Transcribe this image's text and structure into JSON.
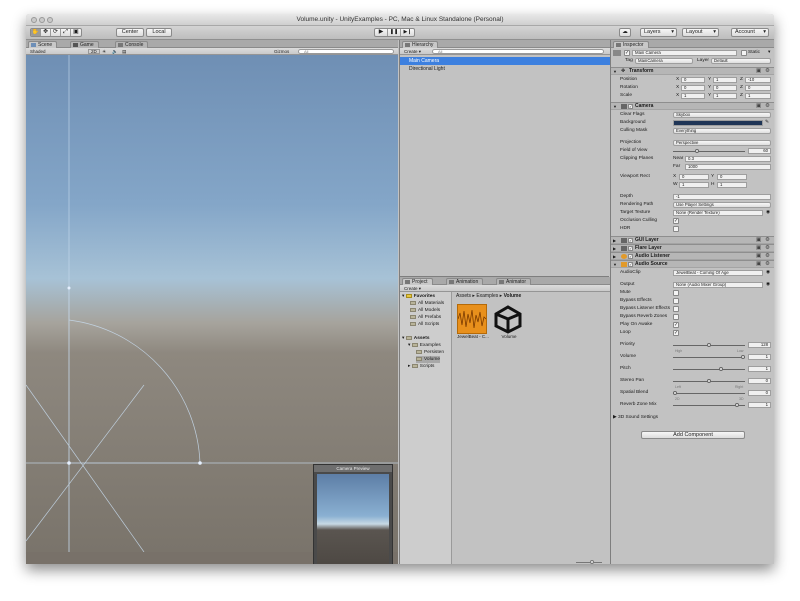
{
  "title": "Volume.unity - UnityExamples - PC, Mac & Linux Standalone (Personal)",
  "toolbar": {
    "tools": [
      "hand-icon",
      "move-icon",
      "rotate-icon",
      "scale-icon",
      "rect-icon"
    ],
    "pivot": "Center",
    "space": "Local",
    "play": "▶",
    "pause": "❚❚",
    "step": "▶❙",
    "cloud": "☁",
    "layers": "Layers",
    "layout": "Layout",
    "account": "Account"
  },
  "scene": {
    "tabs": [
      "Scene",
      "Game",
      "Console"
    ],
    "shading": "Shaded",
    "mode_2d": "2D",
    "gizmos": "Gizmos",
    "search_placeholder": "All",
    "preview_title": "Camera Preview"
  },
  "hierarchy": {
    "tab": "Hierarchy",
    "create": "Create",
    "search_placeholder": "All",
    "items": [
      "Main Camera",
      "Directional Light"
    ]
  },
  "project": {
    "tabs": [
      "Project",
      "Animation",
      "Animator"
    ],
    "create": "Create",
    "favorites_label": "Favorites",
    "favorites": [
      "All Materials",
      "All Models",
      "All Prefabs",
      "All Scripts"
    ],
    "assets_label": "Assets",
    "examples_label": "Examples",
    "example_children": [
      "Persisten",
      "Volume"
    ],
    "scripts_label": "Scripts",
    "breadcrumb": [
      "Assets",
      "Examples",
      "Volume"
    ],
    "asset_items": [
      "JewelBeat - C...",
      "Volume"
    ]
  },
  "inspector": {
    "tab": "Inspector",
    "object_name": "Main Camera",
    "static_label": "Static",
    "tag_label": "Tag",
    "tag": "MainCamera",
    "layer_label": "Layer",
    "layer": "Default",
    "transform": {
      "header": "Transform",
      "rows": [
        {
          "label": "Position",
          "x": "0",
          "y": "1",
          "z": "-10"
        },
        {
          "label": "Rotation",
          "x": "0",
          "y": "0",
          "z": "0"
        },
        {
          "label": "Scale",
          "x": "1",
          "y": "1",
          "z": "1"
        }
      ]
    },
    "camera": {
      "header": "Camera",
      "clear_flags_label": "Clear Flags",
      "clear_flags": "Skybox",
      "background_label": "Background",
      "background_color": "#1f3556",
      "culling_mask_label": "Culling Mask",
      "culling_mask": "Everything",
      "projection_label": "Projection",
      "projection": "Perspective",
      "fov_label": "Field of View",
      "fov": "60",
      "fov_fraction": 0.33,
      "clipping_label": "Clipping Planes",
      "near_label": "Near",
      "near": "0.3",
      "far_label": "Far",
      "far": "1000",
      "viewport_label": "Viewport Rect",
      "vr_x": "0",
      "vr_y": "0",
      "vr_w": "1",
      "vr_h": "1",
      "depth_label": "Depth",
      "depth": "-1",
      "rendering_path_label": "Rendering Path",
      "rendering_path": "Use Player Settings",
      "target_texture_label": "Target Texture",
      "target_texture": "None (Render Texture)",
      "occlusion_label": "Occlusion Culling",
      "hdr_label": "HDR"
    },
    "gui_layer": "GUI Layer",
    "flare_layer": "Flare Layer",
    "audio_listener": "Audio Listener",
    "audio_source": {
      "header": "Audio Source",
      "clip_label": "AudioClip",
      "clip": "JewelBeat - Coming Of Age",
      "output_label": "Output",
      "output": "None (Audio Mixer Group)",
      "mute_label": "Mute",
      "bypass_effects_label": "Bypass Effects",
      "bypass_listener_label": "Bypass Listener Effects",
      "bypass_reverb_label": "Bypass Reverb Zones",
      "play_on_awake_label": "Play On Awake",
      "loop_label": "Loop",
      "priority_label": "Priority",
      "priority": "128",
      "priority_fraction": 0.5,
      "high": "High",
      "low": "Low",
      "volume_label": "Volume",
      "volume": "1",
      "volume_fraction": 1.0,
      "pitch_label": "Pitch",
      "pitch": "1",
      "pitch_fraction": 0.67,
      "stereo_label": "Stereo Pan",
      "stereo": "0",
      "stereo_fraction": 0.5,
      "left": "Left",
      "right": "Right",
      "spatial_label": "Spatial Blend",
      "spatial": "0",
      "spatial_fraction": 0.0,
      "twod": "2D",
      "threed": "3D",
      "reverb_label": "Reverb Zone Mix",
      "reverb": "1",
      "reverb_fraction": 0.91,
      "sound3d_label": "3D Sound Settings"
    },
    "add_component": "Add Component"
  },
  "colors": {
    "selection": "#3d80df",
    "audio_thumb": "#e8901c"
  }
}
